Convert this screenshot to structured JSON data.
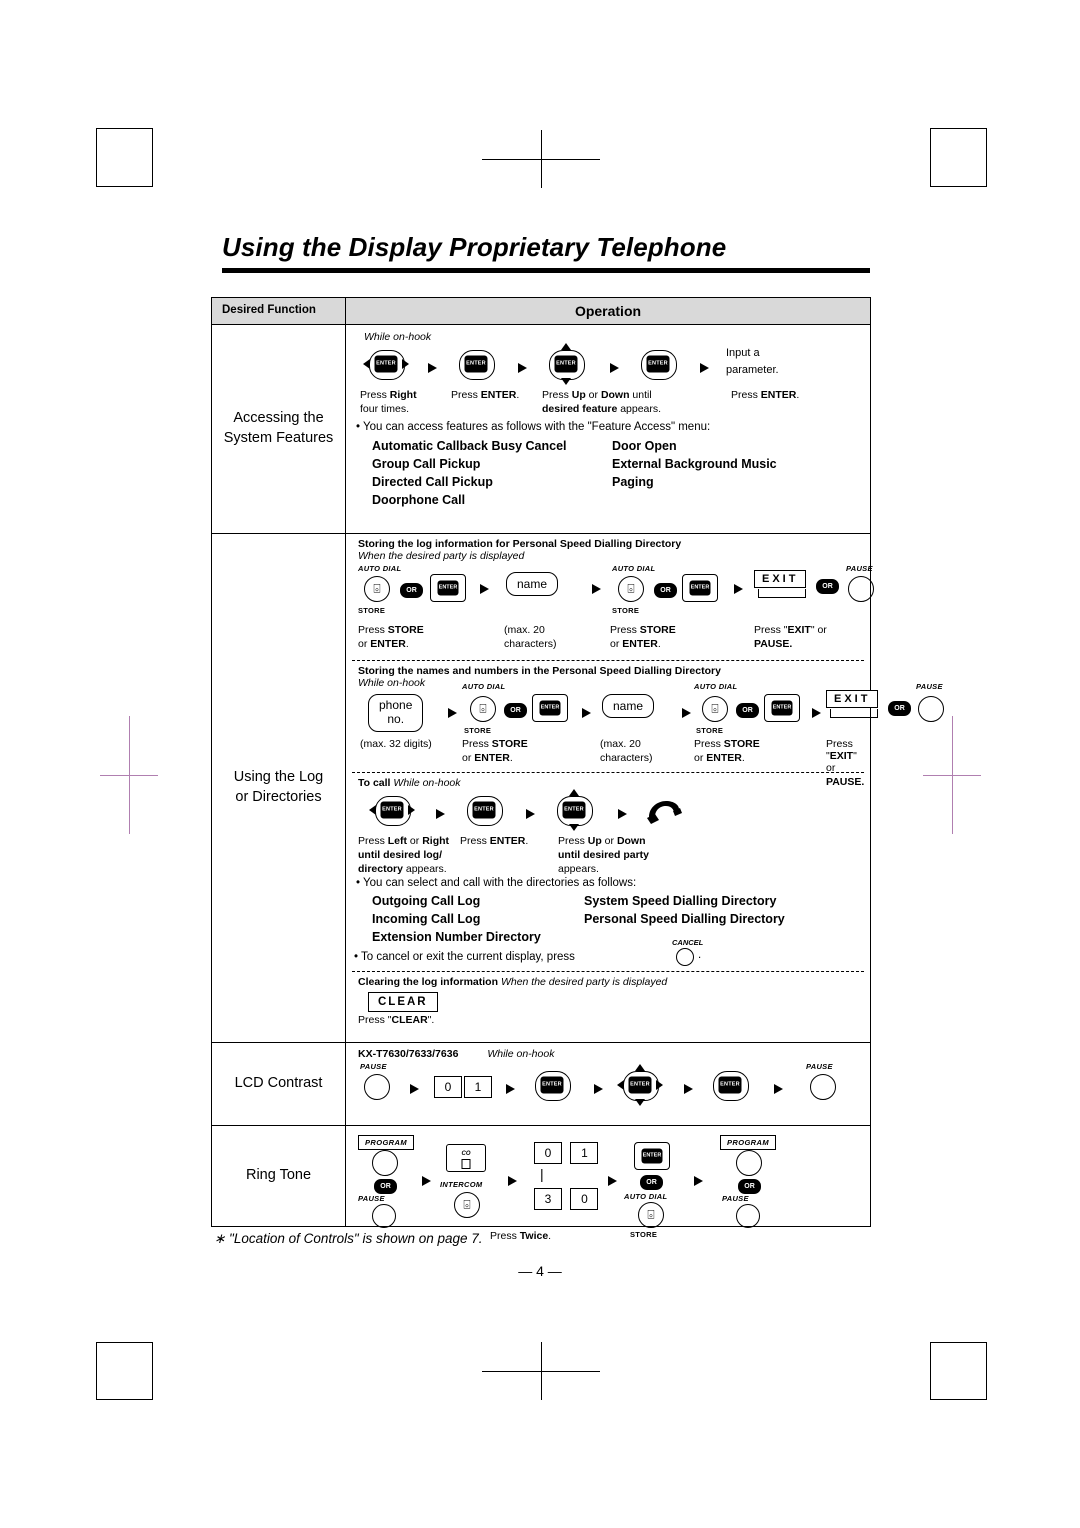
{
  "document": {
    "title": "Using the Display Proprietary Telephone",
    "footnote": "∗ \"Location of Controls\" is shown on page 7.",
    "page_number": "— 4 —"
  },
  "table": {
    "header": {
      "col1": "Desired Function",
      "col2": "Operation"
    },
    "rows": [
      {
        "label": "Accessing the\nSystem Features",
        "note_top": "While on-hook",
        "steps": [
          {
            "caption_top": "",
            "caption": "Press Right",
            "caption2": "four times."
          },
          {
            "caption": "Press ENTER.",
            "caption2": ""
          },
          {
            "caption": "Press Up or Down until",
            "caption2": "desired feature appears."
          },
          {
            "caption": "Press ENTER.",
            "caption2": ""
          },
          {
            "caption": "Input a",
            "caption2": "parameter."
          }
        ],
        "bullet": "• You can access features as follows with the \"Feature Access\" menu:",
        "features_left": [
          "Automatic Callback Busy Cancel",
          "Group Call Pickup",
          "Directed Call Pickup",
          "Doorphone Call"
        ],
        "features_right": [
          "Door Open",
          "External Background Music",
          "Paging"
        ]
      },
      {
        "label": "Using the Log\nor Directories",
        "block1": {
          "heading": "Storing the log information for Personal Speed Dialling Directory",
          "subheading": "When the desired party is displayed",
          "labels_top": [
            "AUTO DIAL",
            "",
            "",
            "AUTO DIAL",
            "",
            "EXIT",
            "PAUSE"
          ],
          "labels_bottom": [
            "STORE",
            "",
            "",
            "STORE",
            "",
            "",
            ""
          ],
          "lcd": "name",
          "captions": [
            "Press STORE",
            "or ENTER.",
            "(max. 20",
            "characters)",
            "Press STORE",
            "or ENTER.",
            "Press \"EXIT\" or",
            "PAUSE."
          ]
        },
        "block2": {
          "heading": "Storing the names and numbers in the Personal Speed Dialling Directory",
          "subheading": "While on-hook",
          "lcd1": "phone\nno.",
          "lcd2": "name",
          "captions": [
            "(max. 32 digits)",
            "Press STORE",
            "or ENTER.",
            "(max. 20",
            "characters)",
            "Press STORE",
            "or ENTER.",
            "Press \"EXIT\" or",
            "PAUSE."
          ]
        },
        "block3": {
          "heading": "To call",
          "heading_italic": "While on-hook",
          "captions": [
            "Press Left or Right",
            "until desired log/",
            "directory appears.",
            "Press ENTER.",
            "Press Up or Down",
            "until desired party",
            "appears."
          ],
          "bullet": "• You can select and call with the directories as follows:",
          "dirs_left": [
            "Outgoing Call Log",
            "Incoming Call Log",
            "Extension Number Directory"
          ],
          "dirs_right": [
            "System Speed Dialling Directory",
            "Personal Speed Dialling Directory"
          ],
          "cancel_line": "• To cancel or exit the current display, press",
          "cancel_label": "CANCEL"
        },
        "block4": {
          "heading": "Clearing the log information",
          "heading_italic": "When the desired party is displayed",
          "key": "CLEAR",
          "caption": "Press \"CLEAR\"."
        }
      },
      {
        "label": "LCD Contrast",
        "model": "KX-T7630/7633/7636",
        "note": "While on-hook",
        "labels": [
          "PAUSE",
          "PAUSE"
        ],
        "keys": [
          "0",
          "1"
        ]
      },
      {
        "label": "Ring Tone",
        "labels": [
          "PROGRAM",
          "PAUSE",
          "CO",
          "INTERCOM",
          "PROGRAM",
          "PAUSE",
          "AUTO DIAL",
          "STORE"
        ],
        "keys": [
          "0",
          "1",
          "3",
          "0"
        ],
        "caption": "Press Twice."
      }
    ]
  }
}
